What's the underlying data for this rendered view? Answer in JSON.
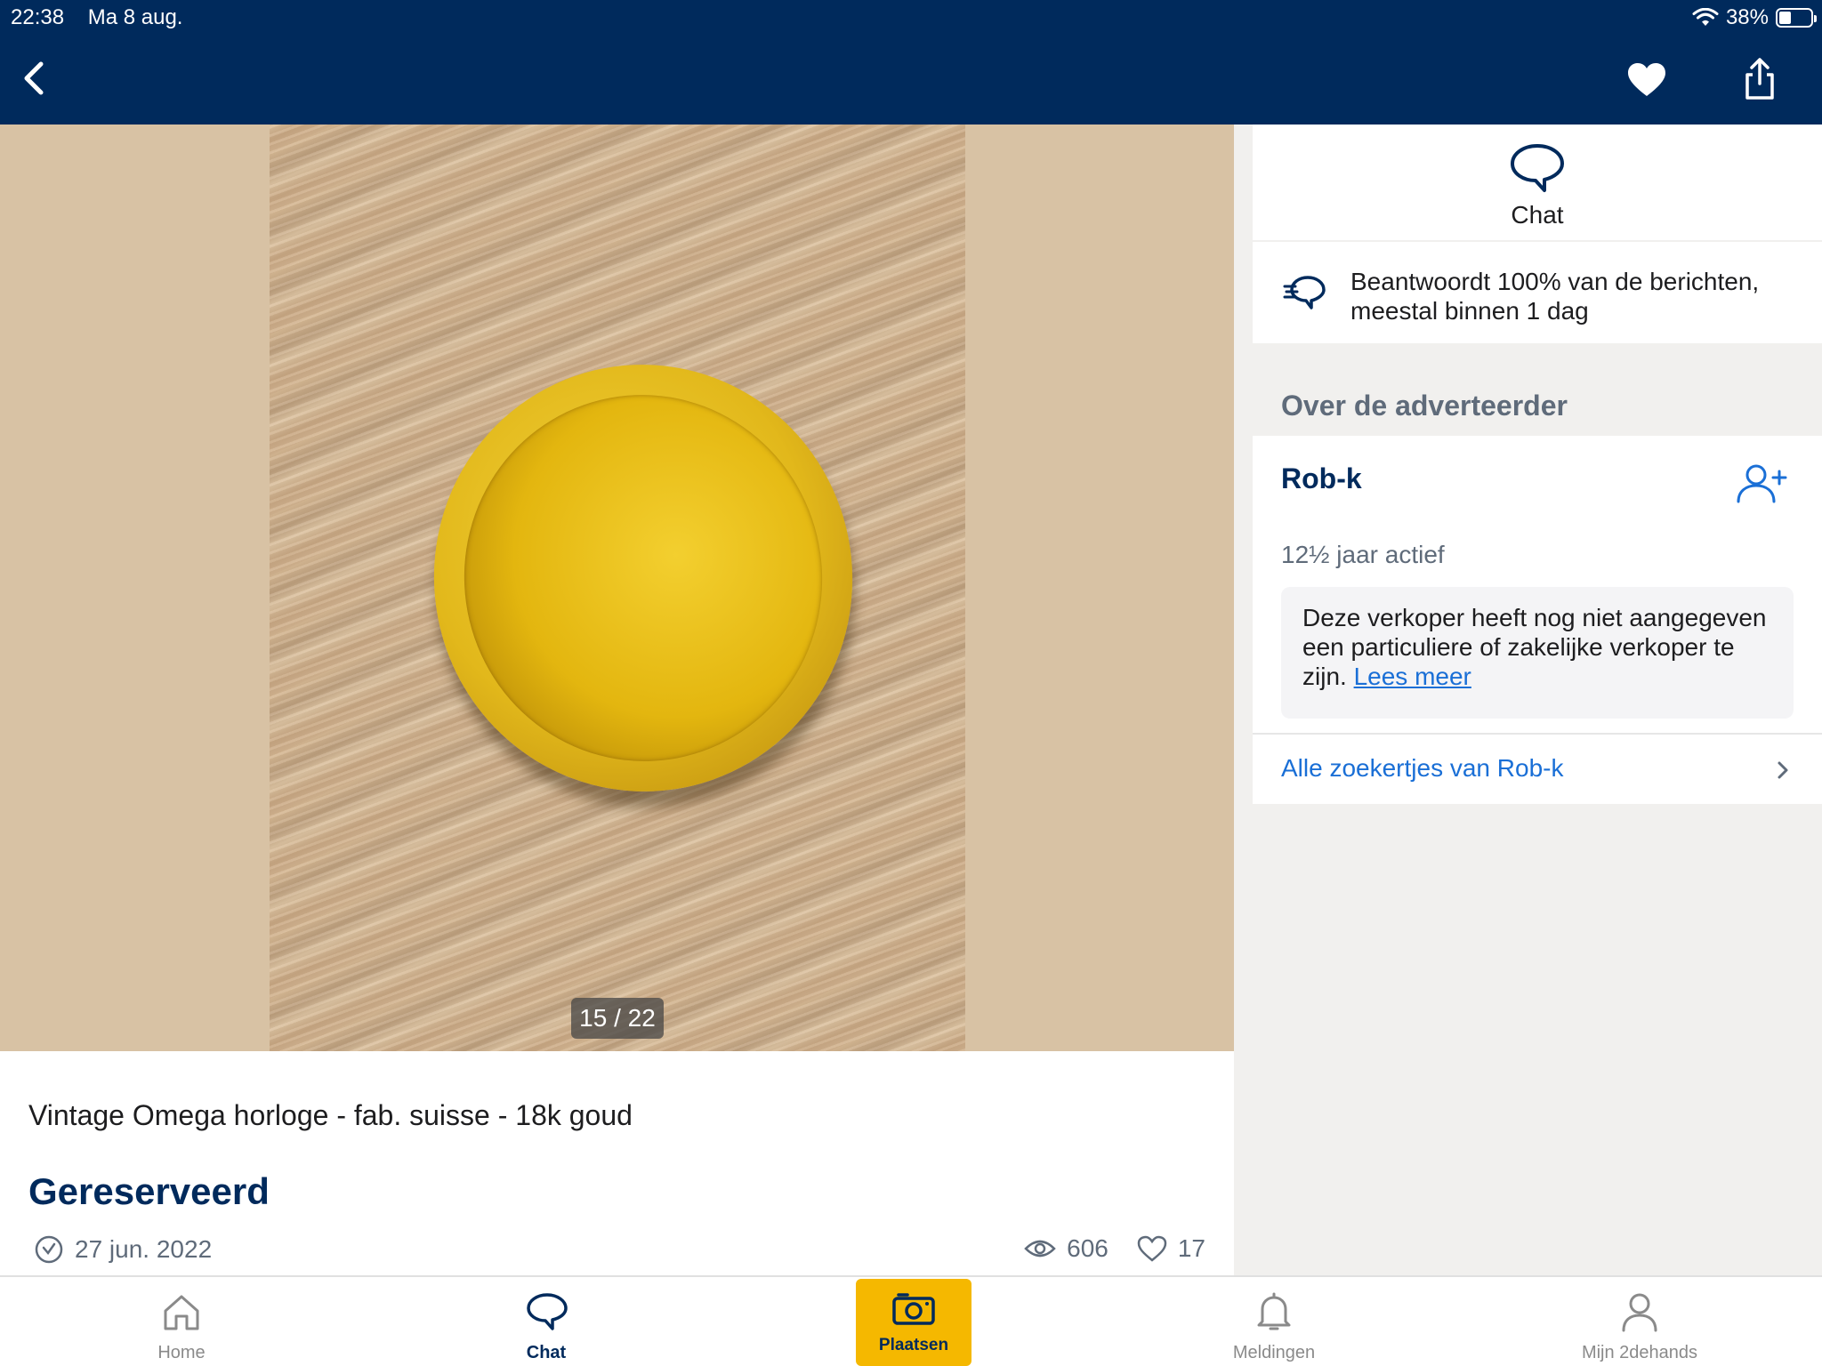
{
  "status_bar": {
    "time": "22:38",
    "date": "Ma 8 aug.",
    "battery_percent": "38%",
    "battery_level": 0.38
  },
  "gallery": {
    "counter": "15 / 22"
  },
  "listing": {
    "title": "Vintage Omega horloge - fab. suisse - 18k goud",
    "status": "Gereserveerd",
    "date": "27 jun. 2022",
    "views": "606",
    "likes": "17"
  },
  "contact": {
    "chat_label": "Chat",
    "reply_text_line1": "Beantwoordt  100% van de berichten,",
    "reply_text_line2": "meestal binnen 1 dag"
  },
  "advertiser": {
    "section_title": "Over de adverteerder",
    "name": "Rob-k",
    "active_since": "12½ jaar actief",
    "info_text": "Deze verkoper heeft nog niet aangegeven een particuliere of zakelijke verkoper te zijn.",
    "info_link": "Lees meer",
    "all_ads_link": "Alle zoekertjes van Rob-k"
  },
  "tabbar": {
    "items": [
      {
        "label": "Home",
        "icon": "home-icon"
      },
      {
        "label": "Chat",
        "icon": "chat-icon"
      },
      {
        "label": "Plaatsen",
        "icon": "camera-icon"
      },
      {
        "label": "Meldingen",
        "icon": "bell-icon"
      },
      {
        "label": "Mijn 2dehands",
        "icon": "user-icon"
      }
    ],
    "active": "Chat"
  },
  "colors": {
    "header": "#002a5c",
    "accent": "#f5b800",
    "link": "#1a6fd6"
  }
}
